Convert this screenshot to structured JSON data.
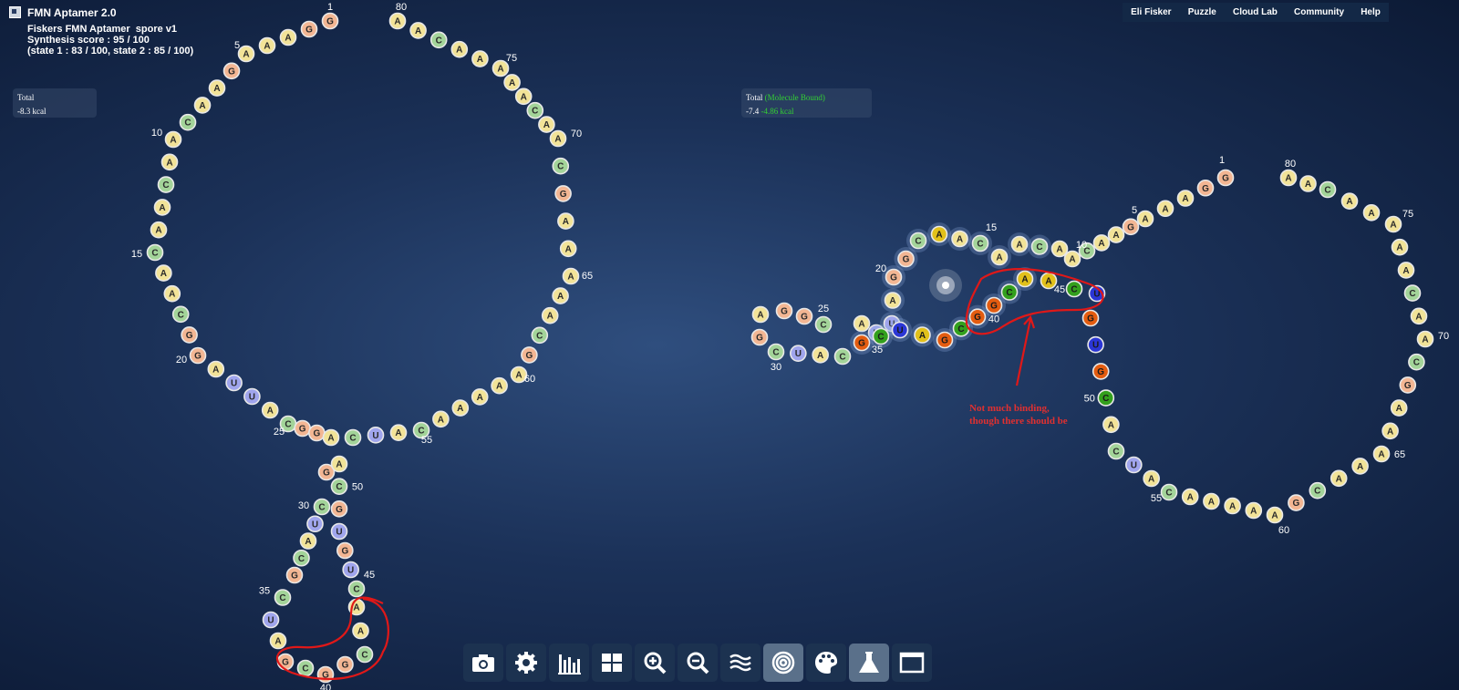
{
  "app": {
    "title": "FMN Aptamer 2.0"
  },
  "puzzle": {
    "name": "Fiskers FMN Aptamer  spore v1",
    "score": "Synthesis score : 95 / 100",
    "states": "(state 1 : 83 / 100, state 2 : 85 / 100)"
  },
  "energy_left": {
    "label": "Total",
    "value": "-8.3 kcal"
  },
  "energy_right": {
    "label": "Total",
    "bound": "(Molecule Bound)",
    "value": "-7.4",
    "bound_value": "-4.86 kcal"
  },
  "nav": [
    "Eli Fisker",
    "Puzzle",
    "Cloud Lab",
    "Community",
    "Help"
  ],
  "annotation": [
    "Not much binding,",
    "though there should be"
  ],
  "sequence": "GGAAAGAACAACAACAACGGAUUACGGAGCUACGCUAGCGGCAACUGUGCACUACAAAAAGCAAAAAGCAACAAAAACAACCA",
  "nucleotide_colors": {
    "A": "#e2c11b",
    "U": "#2b36d6",
    "G": "#e45c10",
    "C": "#33a01d"
  },
  "toolbar": [
    {
      "name": "screenshot-button",
      "icon": "camera-icon"
    },
    {
      "name": "settings-button",
      "icon": "gear-icon"
    },
    {
      "name": "spec-button",
      "icon": "bar-chart-icon"
    },
    {
      "name": "layout-button",
      "icon": "grid-icon"
    },
    {
      "name": "zoom-in-button",
      "icon": "zoom-in-icon"
    },
    {
      "name": "zoom-out-button",
      "icon": "zoom-out-icon"
    },
    {
      "name": "native-mode-button",
      "icon": "waves-icon"
    },
    {
      "name": "target-mode-button",
      "icon": "target-icon",
      "active": true
    },
    {
      "name": "palette-button",
      "icon": "palette-icon"
    },
    {
      "name": "synthesis-button",
      "icon": "flask-icon",
      "active": true
    },
    {
      "name": "fullscreen-button",
      "icon": "window-icon"
    }
  ]
}
